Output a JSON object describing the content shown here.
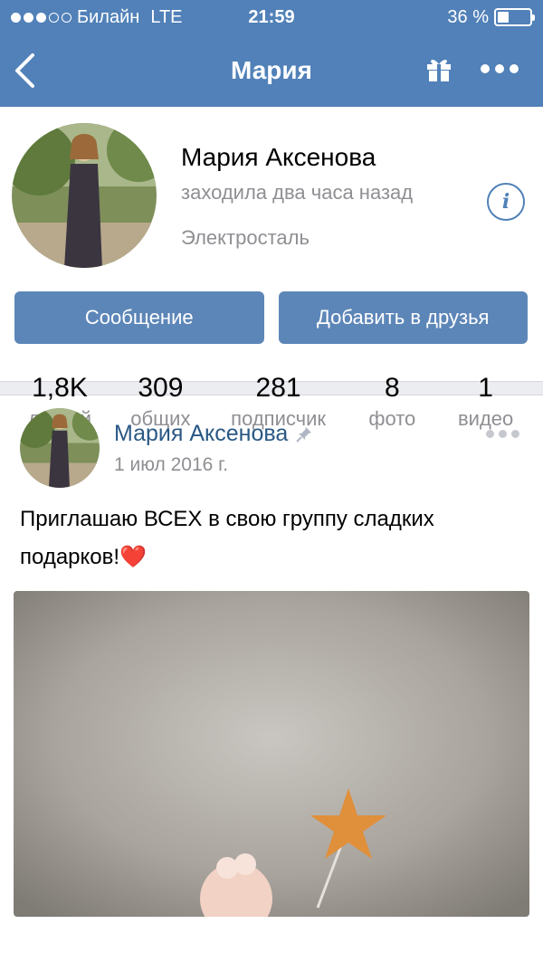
{
  "status_bar": {
    "carrier": "Билайн",
    "network": "LTE",
    "time": "21:59",
    "battery": "36 %",
    "battery_level": 0.36,
    "signal_bars": 3,
    "signal_total": 5
  },
  "nav": {
    "title": "Мария",
    "back_icon": "back-arrow-icon",
    "gift_icon": "gift-icon",
    "more_icon": "more-horizontal-icon"
  },
  "profile": {
    "name": "Мария Аксенова",
    "status": "заходила два часа назад",
    "city": "Электросталь",
    "info_glyph": "i",
    "buttons": {
      "message": "Сообщение",
      "add_friend": "Добавить в друзья"
    },
    "counters": [
      {
        "value": "1,8K",
        "label": "друзей"
      },
      {
        "value": "309",
        "label": "общих"
      },
      {
        "value": "281",
        "label": "подписчик"
      },
      {
        "value": "8",
        "label": "фото"
      },
      {
        "value": "1",
        "label": "видео"
      }
    ]
  },
  "post": {
    "author": "Мария Аксенова",
    "pinned_icon": "pin-icon",
    "date": "1 июл 2016 г.",
    "text": "Приглашаю ВСЕХ в свою группу сладких подарков!❤️"
  },
  "colors": {
    "header": "#5181b8",
    "button": "#5d86b8",
    "link": "#2a5885",
    "muted": "#8f8f94"
  }
}
